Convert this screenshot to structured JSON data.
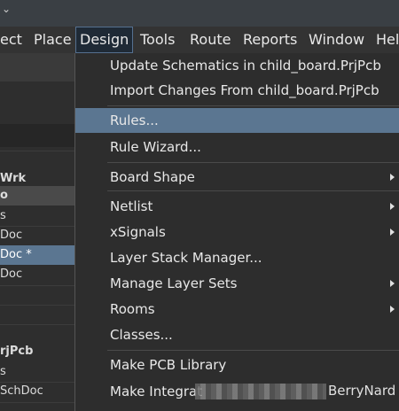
{
  "menubar": {
    "items": [
      "ect",
      "Place",
      "Design",
      "Tools",
      "Route",
      "Reports",
      "Window",
      "Hel"
    ]
  },
  "left_panel": {
    "rows": [
      "Wrk",
      "o",
      "s",
      "Doc",
      "Doc *",
      "Doc",
      "rjPcb",
      "s",
      "SchDoc"
    ]
  },
  "design_menu": {
    "items": [
      {
        "label": "Update Schematics in child_board.PrjPcb"
      },
      {
        "label": "Import Changes From child_board.PrjPcb"
      },
      {
        "label": "Rules..."
      },
      {
        "label": "Rule Wizard..."
      },
      {
        "label": "Board Shape",
        "submenu": true
      },
      {
        "label": "Netlist",
        "submenu": true
      },
      {
        "label": "xSignals",
        "submenu": true
      },
      {
        "label": "Layer Stack Manager..."
      },
      {
        "label": "Manage Layer Sets",
        "submenu": true
      },
      {
        "label": "Rooms",
        "submenu": true
      },
      {
        "label": "Classes..."
      },
      {
        "label": "Make PCB Library"
      },
      {
        "label": "Make Integrat"
      }
    ],
    "highlighted": "Rules...",
    "watermark": "BerryNard"
  }
}
